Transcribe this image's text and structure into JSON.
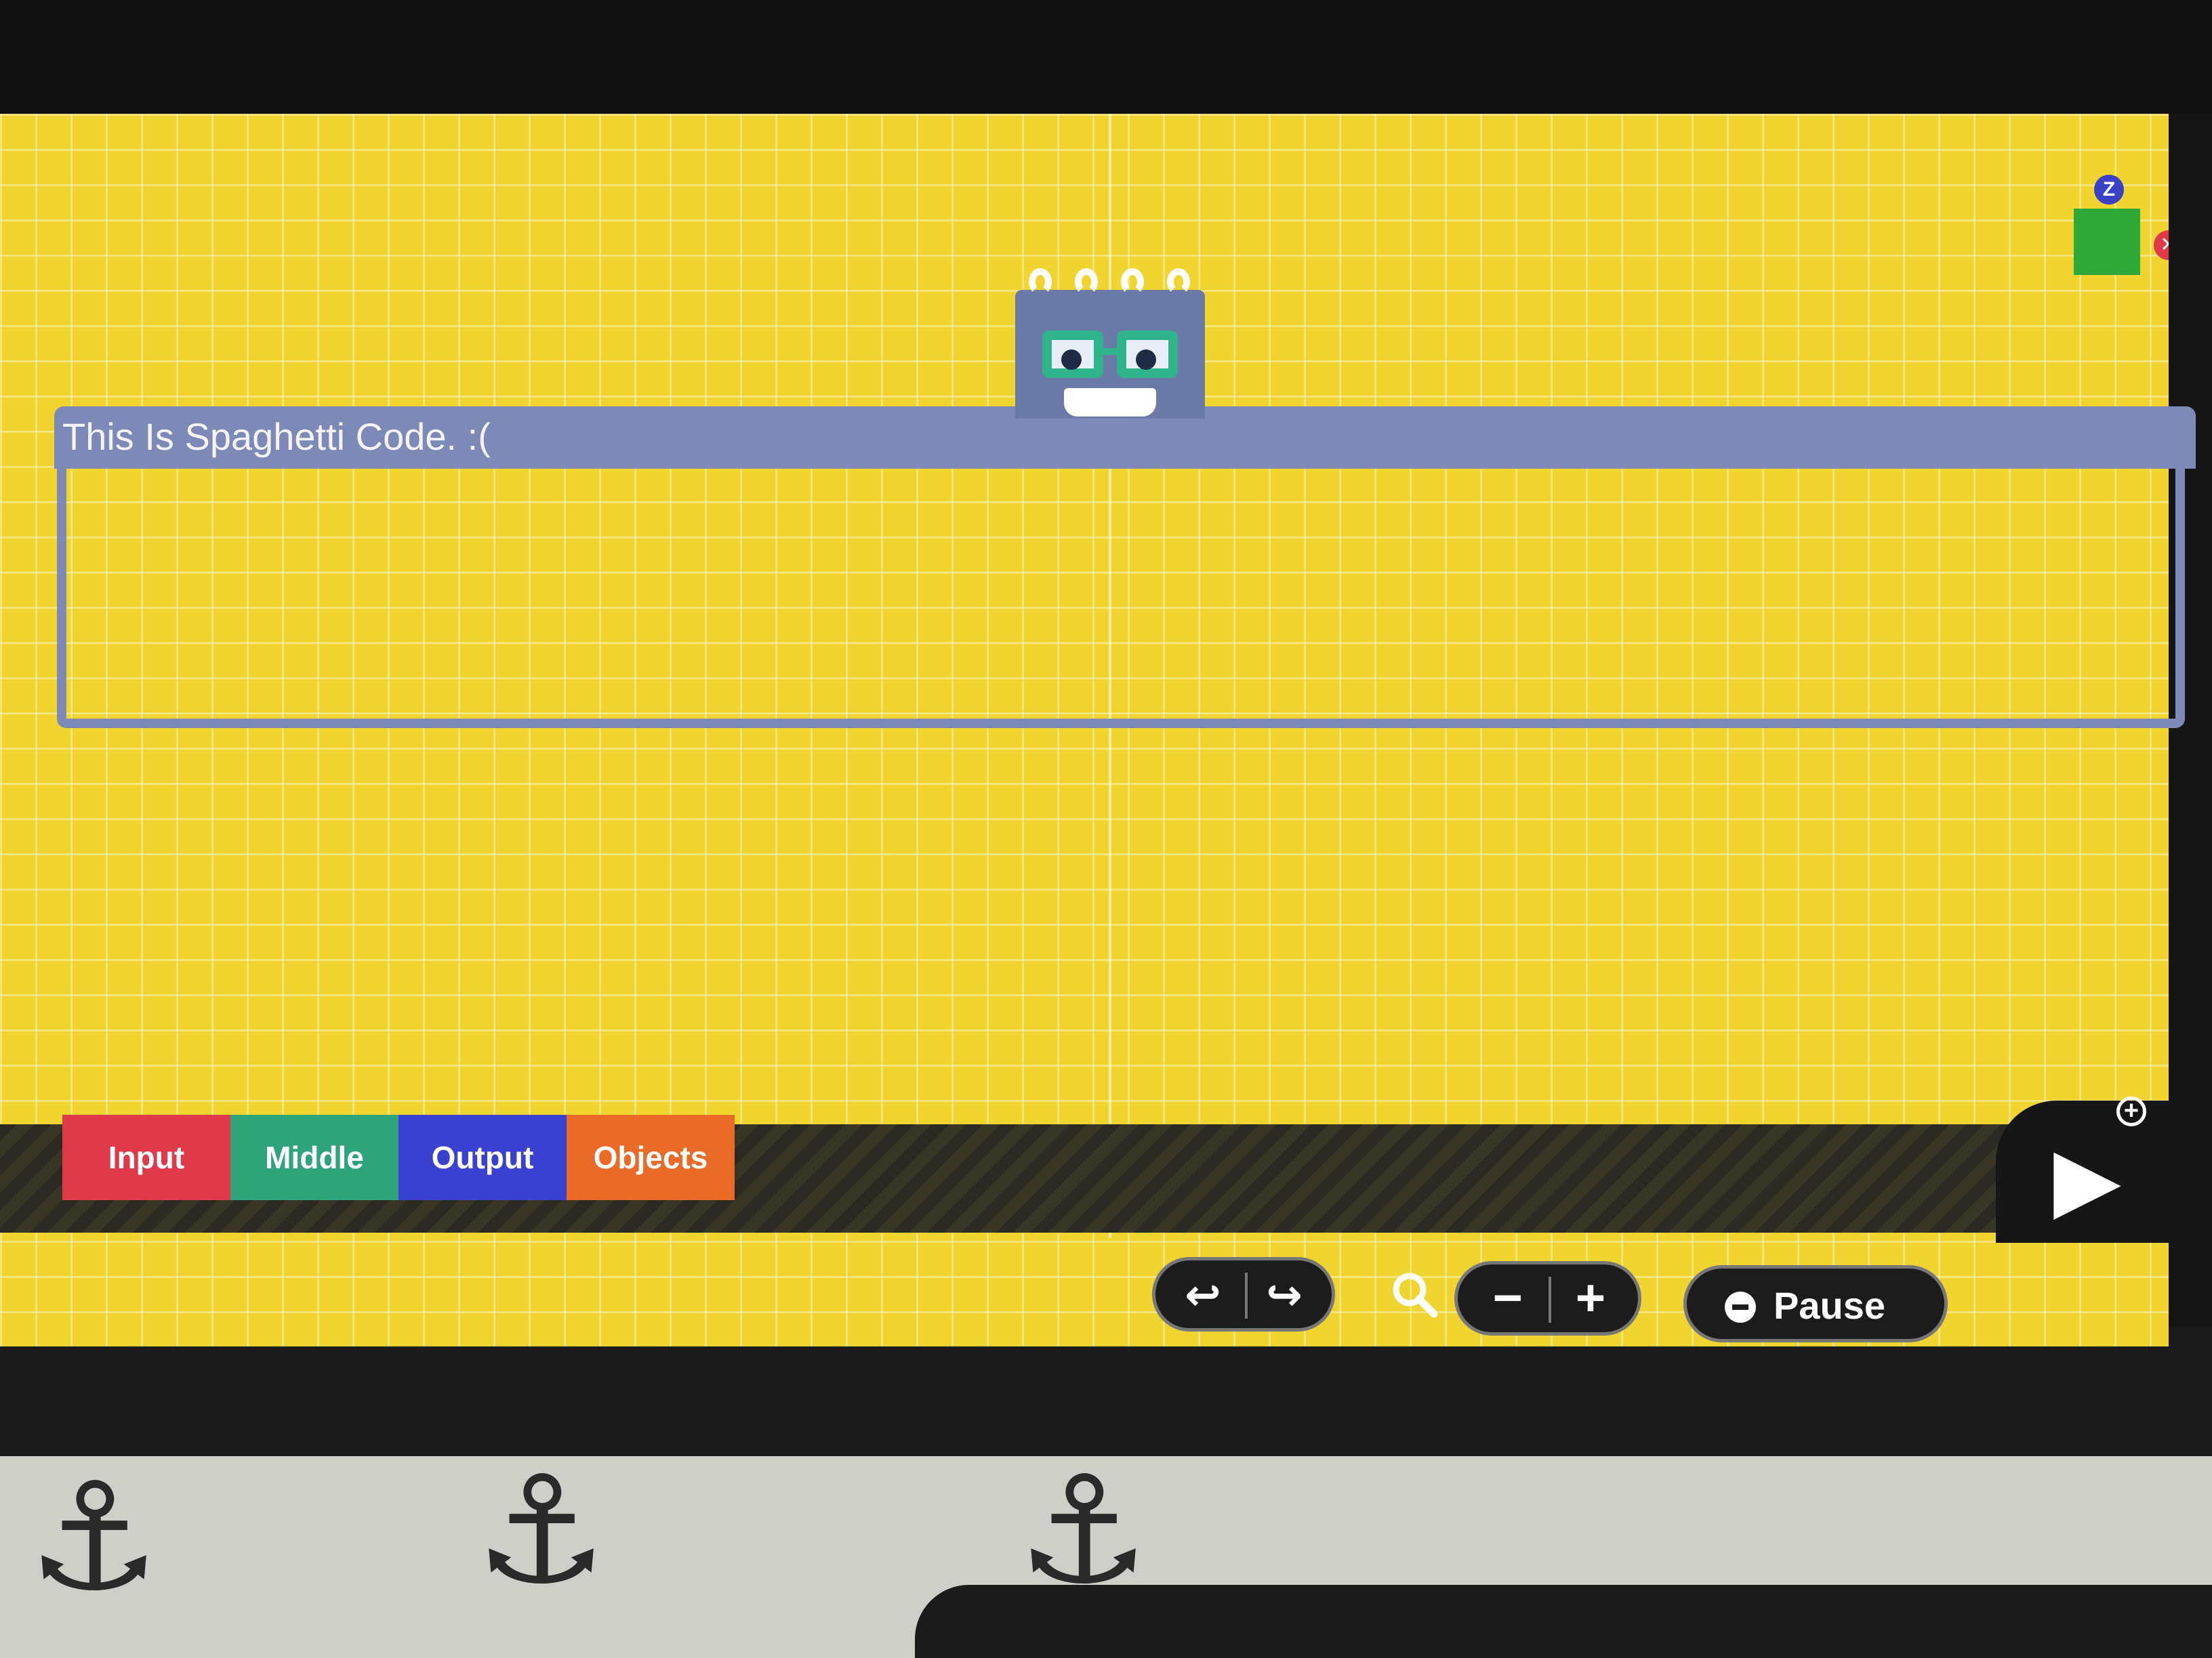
{
  "comment": {
    "title": "This Is Spaghetti Code. :("
  },
  "mascot": {
    "name": "glasses-mascot"
  },
  "widget": {
    "pin_label": "Z",
    "close_label": "✕",
    "square_color": "#2ea838"
  },
  "categories": [
    {
      "label": "Input",
      "color": "#e03a4a"
    },
    {
      "label": "Middle",
      "color": "#2fa37a"
    },
    {
      "label": "Output",
      "color": "#3a40d0"
    },
    {
      "label": "Objects",
      "color": "#ea6a28"
    }
  ],
  "toolbar": {
    "undo_icon": "↩",
    "redo_icon": "↪",
    "zoom_icon": "search-icon",
    "zoom_out": "−",
    "zoom_in": "+",
    "pause_label": "Pause",
    "play_icon": "▶",
    "add_icon": "+"
  },
  "colors": {
    "canvas": "#f0d530",
    "comment_border": "#7d8ab8"
  }
}
